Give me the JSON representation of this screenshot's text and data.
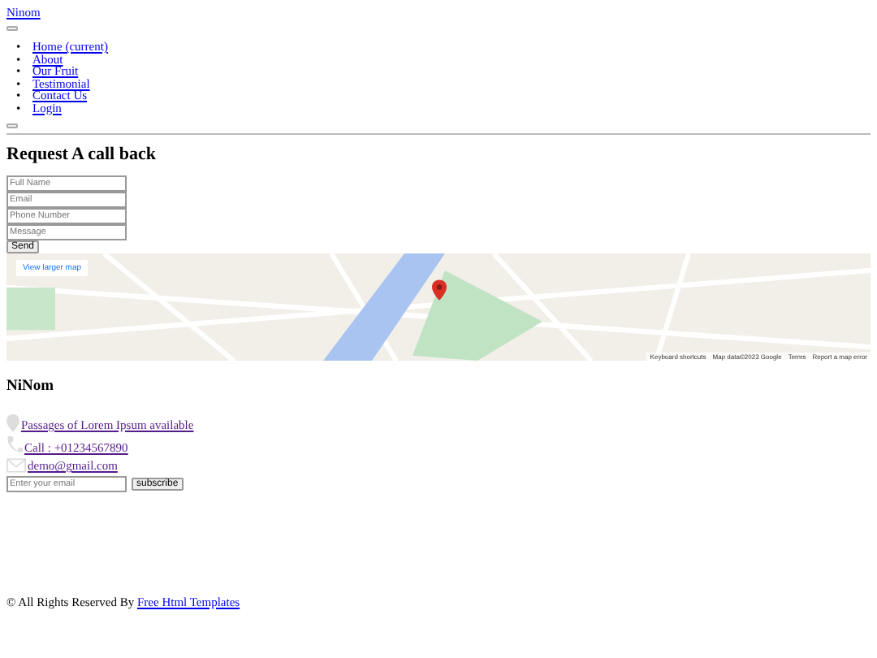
{
  "brand": "Ninom",
  "nav": [
    {
      "marker": "•",
      "label": "Home (current)"
    },
    {
      "marker": "•",
      "label": "About"
    },
    {
      "marker": "•",
      "label": "Our Fruit"
    },
    {
      "marker": "•",
      "label": "Testimonial"
    },
    {
      "marker": "•",
      "label": "Contact Us"
    },
    {
      "marker": "•",
      "label": "Login"
    }
  ],
  "contact_form": {
    "title": "Request A call back",
    "fields": [
      {
        "placeholder": "Full Name"
      },
      {
        "placeholder": "Email"
      },
      {
        "placeholder": "Phone Number"
      },
      {
        "placeholder": "Message"
      }
    ],
    "button": "Send"
  },
  "map": {
    "link": "View larger map",
    "attribution": [
      "Keyboard shortcuts",
      "Map data©2023 Google",
      "Terms",
      "Report a map error"
    ]
  },
  "info": {
    "title": "NiNom",
    "contacts": [
      {
        "kind": "location",
        "text": "Passages of Lorem Ipsum available"
      },
      {
        "kind": "phone",
        "text": "Call : +01234567890"
      },
      {
        "kind": "mail",
        "text": "demo@gmail.com"
      }
    ],
    "newsletter": {
      "placeholder": "Enter your email",
      "button": "subscribe"
    }
  },
  "footer": {
    "text": "© All Rights Reserved By ",
    "link": "Free Html Templates"
  }
}
